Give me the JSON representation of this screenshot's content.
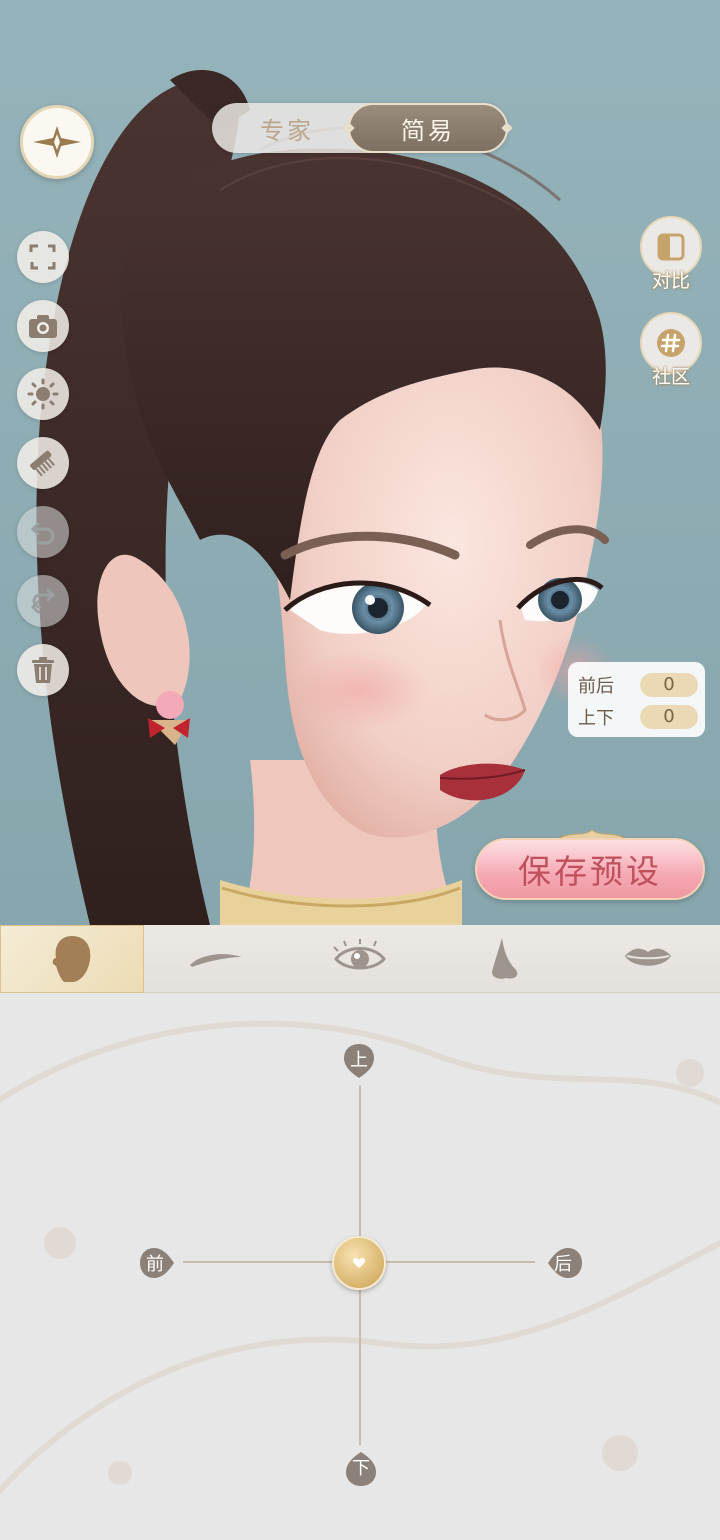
{
  "mode_toggle": {
    "expert_label": "专家",
    "simple_label": "简易",
    "selected": "简易"
  },
  "right_buttons": {
    "compare_label": "对比",
    "community_label": "社区"
  },
  "offset_panel": {
    "front_back_label": "前后",
    "front_back_value": "0",
    "up_down_label": "上下",
    "up_down_value": "0"
  },
  "save_preset_label": "保存预设",
  "left_toolbar": [
    {
      "icon": "menu-star-icon"
    },
    {
      "icon": "fullscreen-icon"
    },
    {
      "icon": "camera-icon"
    },
    {
      "icon": "brightness-icon"
    },
    {
      "icon": "comb-icon"
    },
    {
      "icon": "undo-icon",
      "enabled": false
    },
    {
      "icon": "redo-icon",
      "enabled": false
    },
    {
      "icon": "trash-icon"
    }
  ],
  "category_tabs": [
    {
      "icon": "face-shape-icon",
      "active": true
    },
    {
      "icon": "eyebrow-icon",
      "active": false
    },
    {
      "icon": "eye-icon",
      "active": false
    },
    {
      "icon": "nose-icon",
      "active": false
    },
    {
      "icon": "lips-icon",
      "active": false
    }
  ],
  "joystick": {
    "up": "上",
    "down": "下",
    "front": "前",
    "back": "后",
    "x": 0,
    "y": 0
  },
  "colors": {
    "gold": "#d8b36c",
    "pink": "#f5a9b3",
    "text_brown": "#6b5c4d"
  }
}
